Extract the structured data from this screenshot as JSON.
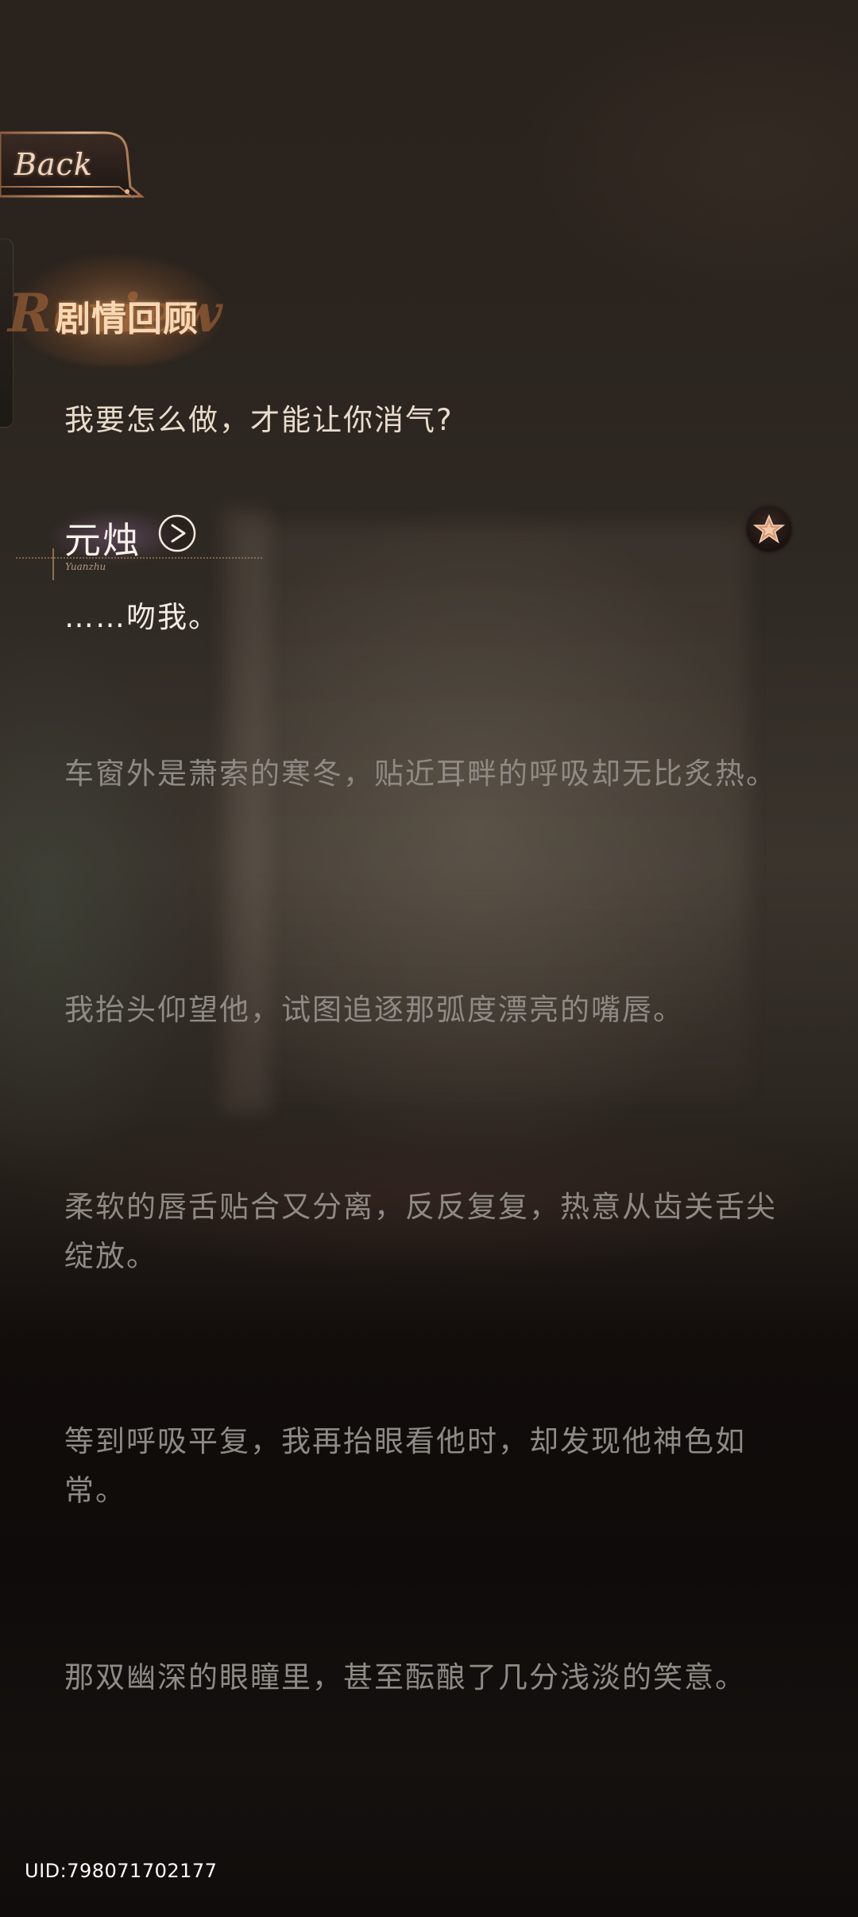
{
  "header": {
    "back_label": "Back",
    "title": "剧情回顾",
    "title_watermark": "Review"
  },
  "dialogue": {
    "player_line": "我要怎么做，才能让你消气?",
    "speaker": {
      "name": "元烛",
      "roman": "Yuanzhu",
      "line": "……吻我。"
    },
    "narration": [
      "车窗外是萧索的寒冬，贴近耳畔的呼吸却无比炙热。",
      "我抬头仰望他，试图追逐那弧度漂亮的嘴唇。",
      "柔软的唇舌贴合又分离，反反复复，热意从齿关舌尖绽放。",
      "等到呼吸平复，我再抬眼看他时，却发现他神色如常。",
      "那双幽深的眼瞳里，甚至酝酿了几分浅淡的笑意。"
    ]
  },
  "footer": {
    "uid": "UID:798071702177"
  },
  "icons": {
    "play": "play-voice-icon",
    "favorite": "star-icon",
    "back": "ornate-back-frame"
  },
  "colors": {
    "title_glow": "#f6d9b7",
    "dialogue_text": "#f3ece4",
    "narration_text": "#8f8a84",
    "accent_copper": "#c98a5e"
  }
}
